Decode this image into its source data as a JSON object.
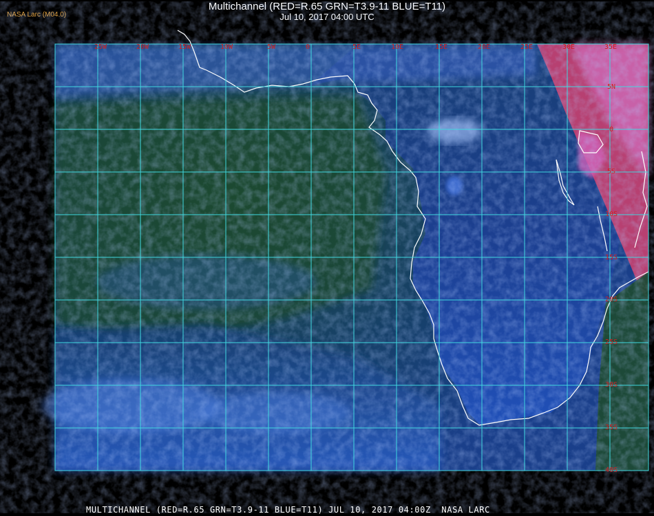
{
  "header": {
    "source_label": "NASA Larc (M04.0)",
    "title": "Multichannel (RED=R.65 GRN=T3.9-11 BLUE=T11)",
    "subtitle": "Jul 10, 2017 04:00 UTC"
  },
  "footer": {
    "caption": "MULTICHANNEL (RED=R.65 GRN=T3.9-11 BLUE=T11) JUL 10, 2017 04:00Z  NASA LARC"
  },
  "map": {
    "grid_color": "#40d8e0",
    "label_color": "#d02020",
    "coast_color": "#ffffff",
    "longitude_labels": [
      "25W",
      "20W",
      "15W",
      "10W",
      "5W",
      "0",
      "5E",
      "10E",
      "15E",
      "20E",
      "25E",
      "30E",
      "35E"
    ],
    "latitude_labels": [
      "5N",
      "0",
      "5S",
      "10S",
      "15S",
      "20S",
      "25S",
      "30S",
      "35S",
      "40S"
    ]
  }
}
